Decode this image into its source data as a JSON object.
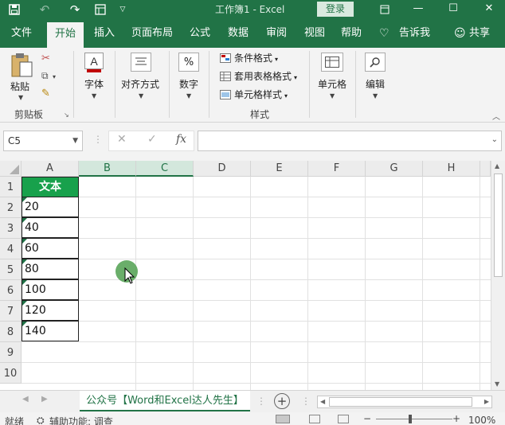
{
  "titlebar": {
    "doc_title": "工作簿1 - Excel",
    "login_label": "登录"
  },
  "ribbon_tabs": [
    {
      "label": "文件"
    },
    {
      "label": "开始"
    },
    {
      "label": "插入"
    },
    {
      "label": "页面布局"
    },
    {
      "label": "公式"
    },
    {
      "label": "数据"
    },
    {
      "label": "审阅"
    },
    {
      "label": "视图"
    },
    {
      "label": "帮助"
    },
    {
      "label": "告诉我"
    },
    {
      "label": "共享"
    }
  ],
  "ribbon": {
    "paste_label": "粘贴",
    "clipboard_group": "剪贴板",
    "font_label": "字体",
    "align_label": "对齐方式",
    "number_label": "数字",
    "percent_symbol": "%",
    "cond_format_label": "条件格式",
    "table_format_label": "套用表格格式",
    "cell_style_label": "单元格样式",
    "styles_group": "样式",
    "cells_label": "单元格",
    "edit_label": "编辑"
  },
  "formula_bar": {
    "name_box": "C5",
    "formula_value": ""
  },
  "grid": {
    "columns": [
      "A",
      "B",
      "C",
      "D",
      "E",
      "F",
      "G",
      "H"
    ],
    "rows": [
      "1",
      "2",
      "3",
      "4",
      "5",
      "6",
      "7",
      "8",
      "9",
      "10"
    ],
    "column_a_values": [
      "文本",
      "20",
      "40",
      "60",
      "80",
      "100",
      "120",
      "140"
    ]
  },
  "sheet_tab": "公众号【Word和Excel达人先生】",
  "statusbar": {
    "ready": "就绪",
    "accessibility": "辅助功能: 调查",
    "zoom": "100%"
  },
  "colors": {
    "accent": "#217346",
    "header_fill": "#18a14c"
  }
}
